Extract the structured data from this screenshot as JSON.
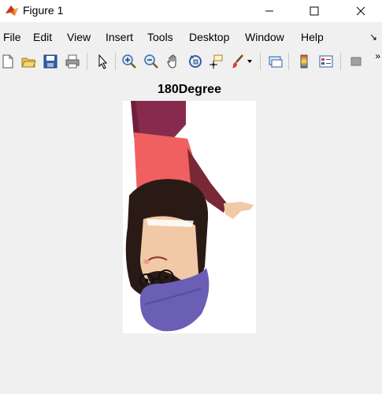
{
  "window": {
    "title": "Figure 1",
    "controls": [
      "minimize",
      "maximize",
      "close"
    ]
  },
  "menu": {
    "items": [
      "File",
      "Edit",
      "View",
      "Insert",
      "Tools",
      "Desktop",
      "Window",
      "Help"
    ],
    "pin_glyph": "↘"
  },
  "toolbar": {
    "buttons": [
      "new-figure-icon",
      "open-file-icon",
      "save-icon",
      "print-icon",
      "edit-plot-icon",
      "zoom-in-icon",
      "zoom-out-icon",
      "pan-icon",
      "rotate-3d-icon",
      "data-cursor-icon",
      "brush-icon",
      "link-plot-icon",
      "insert-colorbar-icon",
      "insert-legend-icon",
      "hide-plot-tools-icon"
    ],
    "more_glyph": "»"
  },
  "axes": {
    "title": "180Degree"
  },
  "colors": {
    "hair": "#2a1a16",
    "skin": "#f2c9a7",
    "shirt": "#f06060",
    "sleeve": "#7a2835",
    "pants": "#862b4d",
    "hood": "#6a5fb5"
  }
}
